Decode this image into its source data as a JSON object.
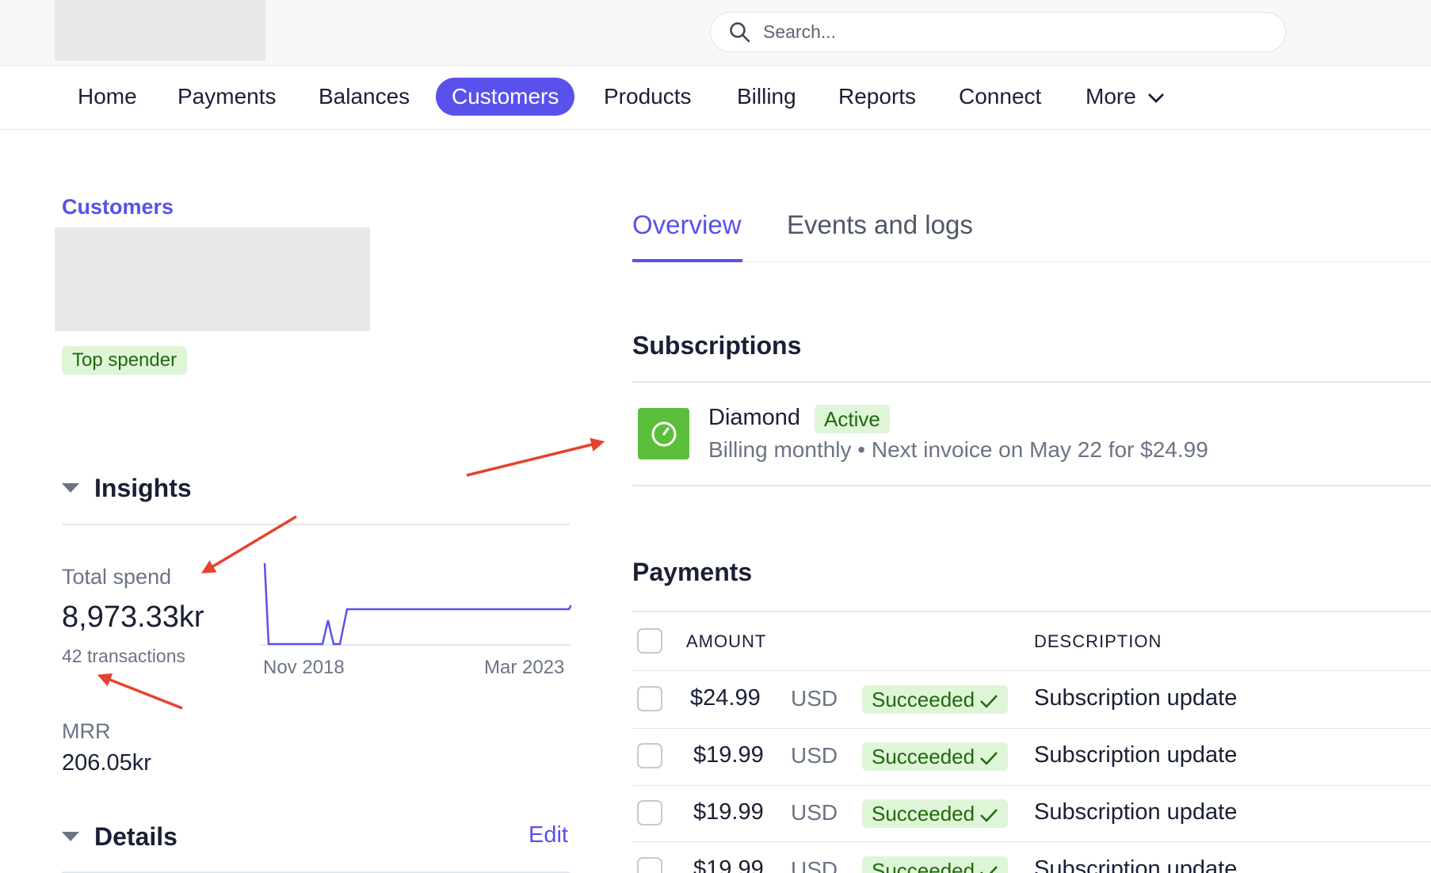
{
  "search": {
    "placeholder": "Search..."
  },
  "nav": {
    "items": [
      {
        "label": "Home"
      },
      {
        "label": "Payments"
      },
      {
        "label": "Balances"
      },
      {
        "label": "Customers"
      },
      {
        "label": "Products"
      },
      {
        "label": "Billing"
      },
      {
        "label": "Reports"
      },
      {
        "label": "Connect"
      },
      {
        "label": "More"
      }
    ],
    "active": "Customers"
  },
  "customer": {
    "breadcrumb": "Customers",
    "badge": "Top spender"
  },
  "insights": {
    "title": "Insights",
    "total_spend_label": "Total spend",
    "total_spend_value": "8,973.33kr",
    "transactions": "42 transactions",
    "chart_start_label": "Nov 2018",
    "chart_end_label": "Mar 2023",
    "mrr_label": "MRR",
    "mrr_value": "206.05kr"
  },
  "details": {
    "title": "Details",
    "edit_label": "Edit"
  },
  "tabs": [
    {
      "label": "Overview"
    },
    {
      "label": "Events and logs"
    }
  ],
  "subscriptions": {
    "title": "Subscriptions",
    "items": [
      {
        "name": "Diamond",
        "status": "Active",
        "meta": "Billing monthly • Next invoice on May 22 for $24.99"
      }
    ]
  },
  "payments": {
    "title": "Payments",
    "columns": {
      "amount": "AMOUNT",
      "description": "DESCRIPTION"
    },
    "rows": [
      {
        "amount": "$24.99",
        "currency": "USD",
        "status": "Succeeded",
        "description": "Subscription update"
      },
      {
        "amount": "$19.99",
        "currency": "USD",
        "status": "Succeeded",
        "description": "Subscription update"
      },
      {
        "amount": "$19.99",
        "currency": "USD",
        "status": "Succeeded",
        "description": "Subscription update"
      },
      {
        "amount": "$19.99",
        "currency": "USD",
        "status": "Succeeded",
        "description": "Subscription update"
      }
    ]
  },
  "colors": {
    "accent": "#5851ec",
    "success_bg": "#dff5d8",
    "success_text": "#1e6a0c",
    "annotation": "#e5432d"
  },
  "icons": [
    "search-icon",
    "chevron-down-icon",
    "caret-down-icon",
    "subscription-clock-icon",
    "checkmark-icon",
    "annotation-arrow"
  ]
}
